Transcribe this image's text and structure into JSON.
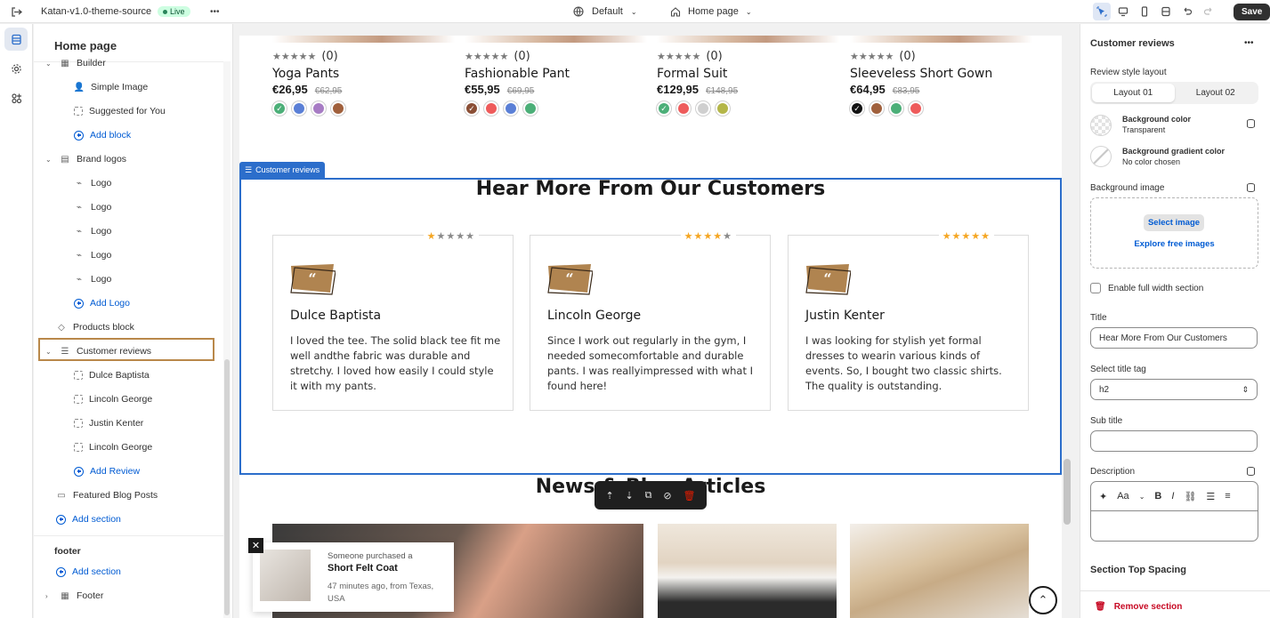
{
  "topbar": {
    "theme_name": "Katan-v1.0-theme-source",
    "status": "Live",
    "more": "•••",
    "market": "Default",
    "page": "Home page",
    "save": "Save"
  },
  "left_panel": {
    "title": "Home page",
    "items": [
      {
        "label": "Builder"
      },
      {
        "label": "Simple Image"
      },
      {
        "label": "Suggested for You"
      },
      {
        "label": "Add block"
      },
      {
        "label": "Brand logos"
      },
      {
        "label": "Logo"
      },
      {
        "label": "Logo"
      },
      {
        "label": "Logo"
      },
      {
        "label": "Logo"
      },
      {
        "label": "Logo"
      },
      {
        "label": "Add Logo"
      },
      {
        "label": "Products block"
      },
      {
        "label": "Customer reviews"
      },
      {
        "label": "Dulce Baptista"
      },
      {
        "label": "Lincoln George"
      },
      {
        "label": "Justin Kenter"
      },
      {
        "label": "Lincoln George"
      },
      {
        "label": "Add Review"
      },
      {
        "label": "Featured Blog Posts"
      },
      {
        "label": "Add section"
      },
      {
        "label": "footer"
      },
      {
        "label": "Add section"
      },
      {
        "label": "Footer"
      }
    ]
  },
  "products": [
    {
      "stars": "★★★★★",
      "count": "(0)",
      "name": "Yoga Pants",
      "price": "€26,95",
      "old_price": "€62,95",
      "colors": [
        "#4caf78",
        "#5a7fd6",
        "#a77cc4",
        "#a0603c"
      ]
    },
    {
      "stars": "★★★★★",
      "count": "(0)",
      "name": "Fashionable Pant",
      "price": "€55,95",
      "old_price": "€69,95",
      "colors": [
        "#8a4e35",
        "#ee5b5b",
        "#5a7fd6",
        "#4caf78"
      ]
    },
    {
      "stars": "★★★★★",
      "count": "(0)",
      "name": "Formal Suit",
      "price": "€129,95",
      "old_price": "€148,95",
      "colors": [
        "#4caf78",
        "#ee5b5b",
        "#cfcfcf",
        "#b4b648"
      ]
    },
    {
      "stars": "★★★★★",
      "count": "(0)",
      "name": "Sleeveless Short Gown",
      "price": "€64,95",
      "old_price": "€83,95",
      "colors": [
        "#111111",
        "#a0603c",
        "#4caf78",
        "#ee5b5b"
      ]
    }
  ],
  "reviews_section": {
    "tag": "Customer reviews",
    "heading": "Hear More From Our Customers",
    "reviews": [
      {
        "stars_filled": "★",
        "stars_empty": "★★★★",
        "name": "Dulce Baptista",
        "text": "I loved the tee. The solid black tee fit me well andthe fabric was durable and stretchy. I loved how easily I could style it with my pants."
      },
      {
        "stars_filled": "★★★★",
        "stars_empty": "★",
        "name": "Lincoln George",
        "text": "Since I work out regularly in the gym, I needed somecomfortable and durable pants. I was reallyimpressed with what I found here!"
      },
      {
        "stars_filled": "★★★★★",
        "stars_empty": "",
        "name": "Justin Kenter",
        "text": "I was looking for stylish yet formal dresses to wearin various kinds of events. So, I bought two classic shirts. The quality is outstanding."
      }
    ]
  },
  "next_section": {
    "heading": "News & Blog Articles"
  },
  "toast": {
    "line1": "Someone purchased a",
    "product": "Short Felt Coat",
    "meta": "47 minutes ago, from Texas, USA",
    "close": "✕"
  },
  "right_panel": {
    "title": "Customer reviews",
    "more": "•••",
    "layout_label": "Review style layout",
    "layout_options": [
      "Layout 01",
      "Layout 02"
    ],
    "bg_color_label": "Background color",
    "bg_color_value": "Transparent",
    "bg_gradient_label": "Background gradient color",
    "bg_gradient_value": "No color chosen",
    "bg_image_label": "Background image",
    "select_image": "Select image",
    "explore_images": "Explore free images",
    "full_width": "Enable full width section",
    "title_label": "Title",
    "title_value": "Hear More From Our Customers",
    "title_tag_label": "Select title tag",
    "title_tag_value": "h2",
    "subtitle_label": "Sub title",
    "subtitle_value": "",
    "description_label": "Description",
    "spacing_label": "Section Top Spacing",
    "remove": "Remove section"
  },
  "colors": {
    "accent": "#2c6ecb",
    "brand_quote": "#b08450",
    "star": "#f5a623"
  }
}
